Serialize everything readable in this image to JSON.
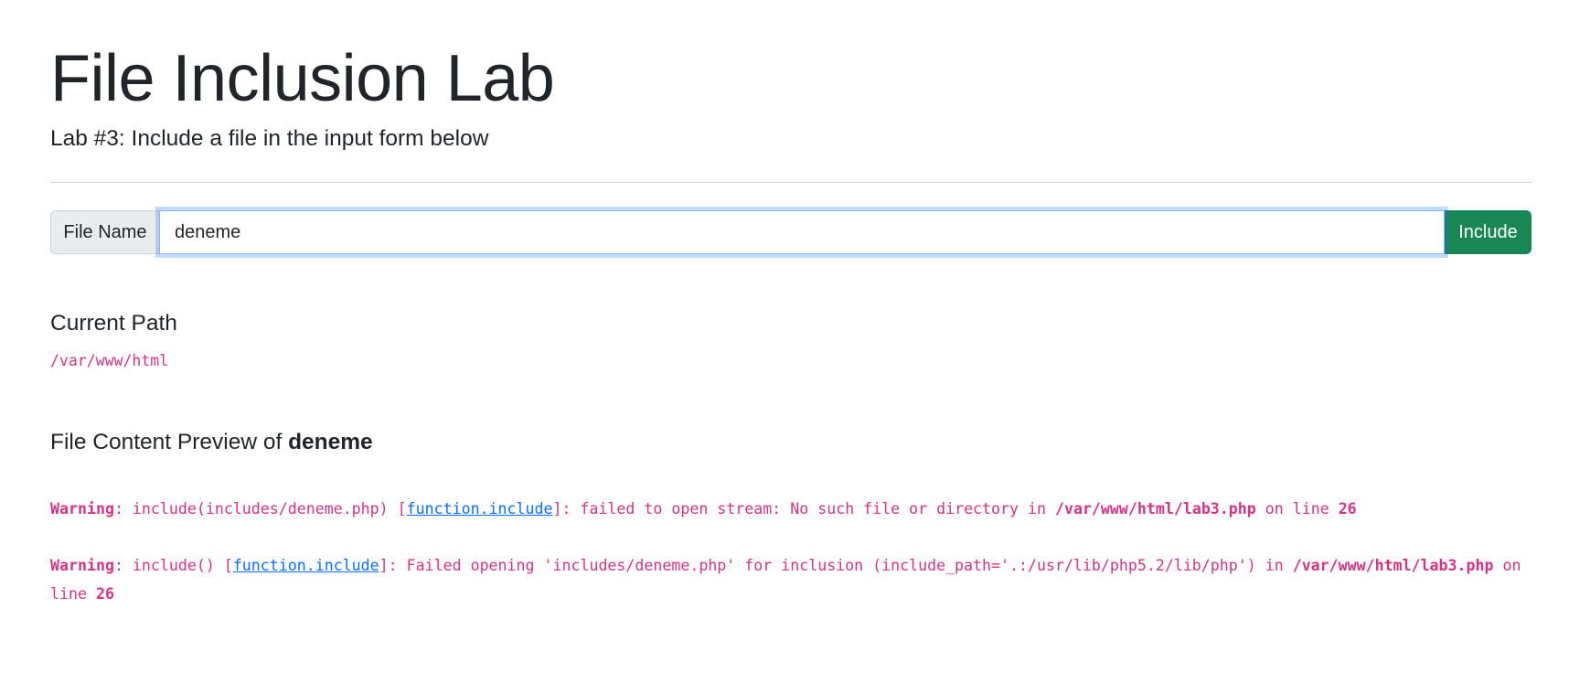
{
  "header": {
    "title": "File Inclusion Lab",
    "subtitle": "Lab #3: Include a file in the input form below"
  },
  "form": {
    "addon_label": "File Name",
    "input_value": "deneme",
    "button_label": "Include"
  },
  "current_path": {
    "heading": "Current Path",
    "value": "/var/www/html"
  },
  "preview": {
    "heading_prefix": "File Content Preview of ",
    "filename": "deneme",
    "warnings": [
      {
        "label": "Warning",
        "text_before": ": include(includes/deneme.php) [",
        "link": "function.include",
        "text_after": "]: failed to open stream: No such file or directory in ",
        "file": "/var/www/html/lab3.php",
        "on_line": " on line ",
        "line": "26"
      },
      {
        "label": "Warning",
        "text_before": ": include() [",
        "link": "function.include",
        "text_after": "]: Failed opening 'includes/deneme.php' for inclusion (include_path='.:/usr/lib/php5.2/lib/php') in ",
        "file": "/var/www/html/lab3.php",
        "on_line": " on line ",
        "line": "26"
      }
    ]
  },
  "colors": {
    "accent_success": "#198754",
    "code_pink": "#d63384",
    "link_blue": "#0d6efd",
    "focus_ring": "#86b7fe"
  }
}
